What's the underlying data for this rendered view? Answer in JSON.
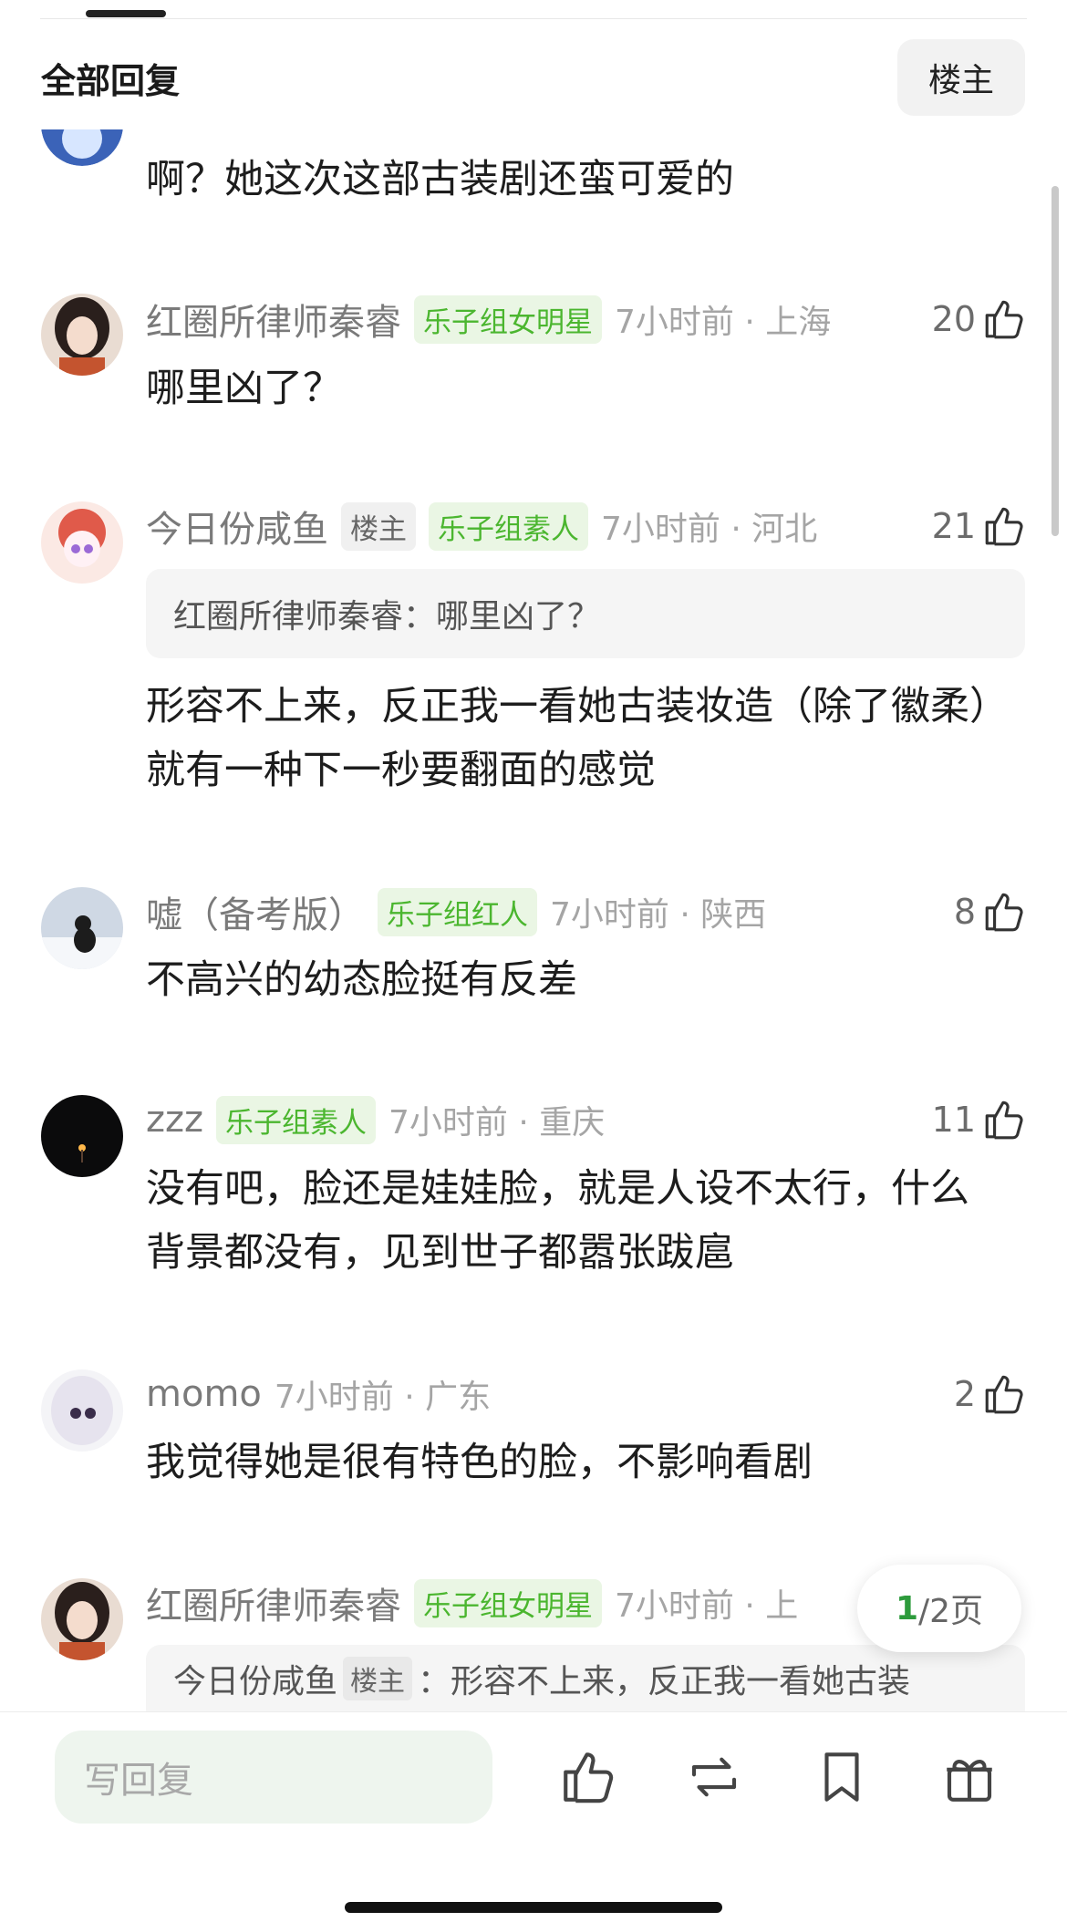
{
  "header": {
    "title": "全部回复",
    "filter_label": "楼主"
  },
  "comments": [
    {
      "text": "啊？她这次这部古装剧还蛮可爱的"
    },
    {
      "username": "红圈所律师秦睿",
      "tag": "乐子组女明星",
      "time_loc": "7小时前 · 上海",
      "likes": "20",
      "text": "哪里凶了？"
    },
    {
      "username": "今日份咸鱼",
      "op_tag": "楼主",
      "tag": "乐子组素人",
      "time_loc": "7小时前 · 河北",
      "likes": "21",
      "quote": "红圈所律师秦睿：哪里凶了？",
      "text": "形容不上来，反正我一看她古装妆造（除了徽柔）就有一种下一秒要翻面的感觉"
    },
    {
      "username": "嘘（备考版）",
      "tag": "乐子组红人",
      "time_loc": "7小时前 · 陕西",
      "likes": "8",
      "text": "不高兴的幼态脸挺有反差"
    },
    {
      "username": "zzz",
      "tag": "乐子组素人",
      "time_loc": "7小时前 · 重庆",
      "likes": "11",
      "text": "没有吧，脸还是娃娃脸，就是人设不太行，什么背景都没有，见到世子都嚣张跋扈"
    },
    {
      "username": "momo",
      "time_loc": "7小时前 · 广东",
      "likes": "2",
      "text": "我觉得她是很有特色的脸，不影响看剧"
    },
    {
      "username": "红圈所律师秦睿",
      "tag": "乐子组女明星",
      "time_loc": "7小时前 · 上",
      "quote_user": "今日份咸鱼",
      "quote_tag": "楼主",
      "quote_text": "：形容不上来，反正我一看她古装"
    }
  ],
  "pagination": {
    "current": "1",
    "rest": "/2页"
  },
  "bottom_bar": {
    "reply_placeholder": "写回复"
  },
  "colors": {
    "accent_green": "#4bb62f",
    "tag_bg": "#eaf6e4",
    "page_current": "#2d9b3c"
  }
}
